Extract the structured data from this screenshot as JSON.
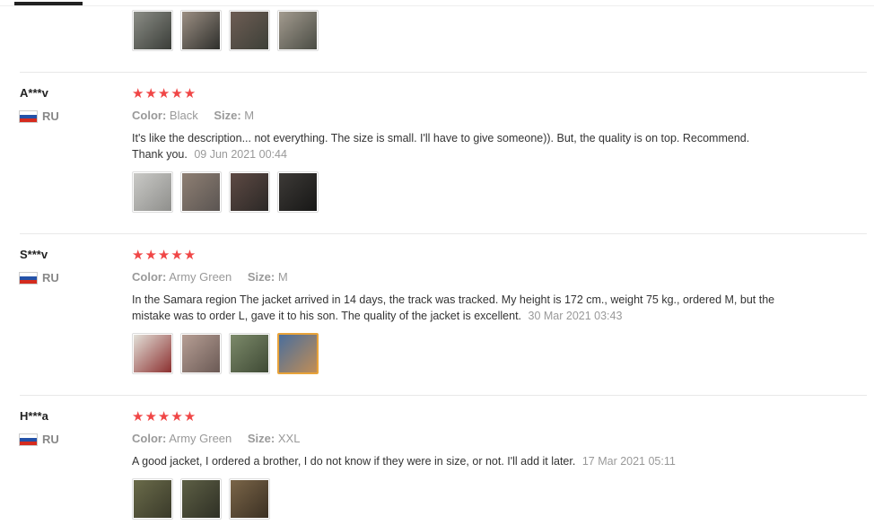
{
  "top_thumbs": [
    {
      "colors": [
        "#8b8d86",
        "#3a3d38"
      ]
    },
    {
      "colors": [
        "#9c8f83",
        "#2e2f2c"
      ]
    },
    {
      "colors": [
        "#6e5d54",
        "#3d4038"
      ]
    },
    {
      "colors": [
        "#a39b8f",
        "#4a4c44"
      ]
    }
  ],
  "reviews": [
    {
      "user": "A***v",
      "country": "RU",
      "stars": "★★★★★",
      "color_label": "Color:",
      "color_value": "Black",
      "size_label": "Size:",
      "size_value": "M",
      "text": "It's like the description... not everything. The size is small. I'll have to give someone)). But, the quality is on top. Recommend. Thank you.",
      "date": "09 Jun 2021 00:44",
      "thumbs": [
        {
          "colors": [
            "#c9c9c6",
            "#8f8f8c"
          ]
        },
        {
          "colors": [
            "#8e7f73",
            "#5b5552"
          ]
        },
        {
          "colors": [
            "#5e4a44",
            "#2b2826"
          ]
        },
        {
          "colors": [
            "#3d3a37",
            "#171716"
          ]
        }
      ]
    },
    {
      "user": "S***v",
      "country": "RU",
      "stars": "★★★★★",
      "color_label": "Color:",
      "color_value": "Army Green",
      "size_label": "Size:",
      "size_value": "M",
      "text": "In the Samara region The jacket arrived in 14 days, the track was tracked. My height is 172 cm., weight 75 kg., ordered M, but the mistake was to order L, gave it to his son. The quality of the jacket is excellent.",
      "date": "30 Mar 2021 03:43",
      "thumbs": [
        {
          "colors": [
            "#e2e0d8",
            "#8c3030"
          ]
        },
        {
          "colors": [
            "#b69e94",
            "#6b5a55"
          ]
        },
        {
          "colors": [
            "#7c8a6a",
            "#3f4a35"
          ]
        },
        {
          "colors": [
            "#4a6e9c",
            "#c08d56"
          ]
        }
      ]
    },
    {
      "user": "H***a",
      "country": "RU",
      "stars": "★★★★★",
      "color_label": "Color:",
      "color_value": "Army Green",
      "size_label": "Size:",
      "size_value": "XXL",
      "text": "A good jacket, I ordered a brother, I do not know if they were in size, or not. I'll add it later.",
      "date": "17 Mar 2021 05:11",
      "thumbs": [
        {
          "colors": [
            "#6a6b4a",
            "#3a3a2a"
          ]
        },
        {
          "colors": [
            "#5d5f45",
            "#2f3025"
          ]
        },
        {
          "colors": [
            "#7a6548",
            "#3b3023"
          ]
        }
      ]
    }
  ]
}
